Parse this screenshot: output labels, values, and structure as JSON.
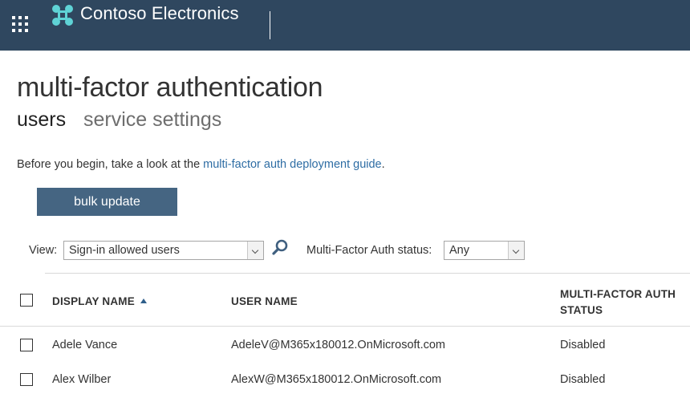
{
  "header": {
    "brand_name": "Contoso Electronics",
    "icons": {
      "app_launcher": "waffle-grid-icon",
      "brand_logo": "contoso-logo-icon"
    },
    "background": "#2f475f"
  },
  "page": {
    "title": "multi-factor authentication",
    "tabs": [
      {
        "label": "users",
        "active": true
      },
      {
        "label": "service settings",
        "active": false
      }
    ]
  },
  "intro": {
    "prefix": "Before you begin, take a look at the ",
    "link_text": "multi-factor auth deployment guide",
    "suffix": "."
  },
  "actions": {
    "bulk_update_label": "bulk update"
  },
  "filters": {
    "view_label": "View:",
    "view_value": "Sign-in allowed users",
    "search_icon": "search-icon",
    "status_label": "Multi-Factor Auth status:",
    "status_value": "Any"
  },
  "table": {
    "columns": {
      "display_name": "DISPLAY NAME",
      "user_name": "USER NAME",
      "mfa_status_line1": "MULTI-FACTOR AUTH",
      "mfa_status_line2": "STATUS"
    },
    "sort": {
      "column": "display_name",
      "direction": "ascending"
    },
    "rows": [
      {
        "display_name": "Adele Vance",
        "user_name": "AdeleV@M365x180012.OnMicrosoft.com",
        "status": "Disabled"
      },
      {
        "display_name": "Alex Wilber",
        "user_name": "AlexW@M365x180012.OnMicrosoft.com",
        "status": "Disabled"
      }
    ]
  },
  "colors": {
    "accent_button": "#456582",
    "link": "#2e6da4"
  }
}
